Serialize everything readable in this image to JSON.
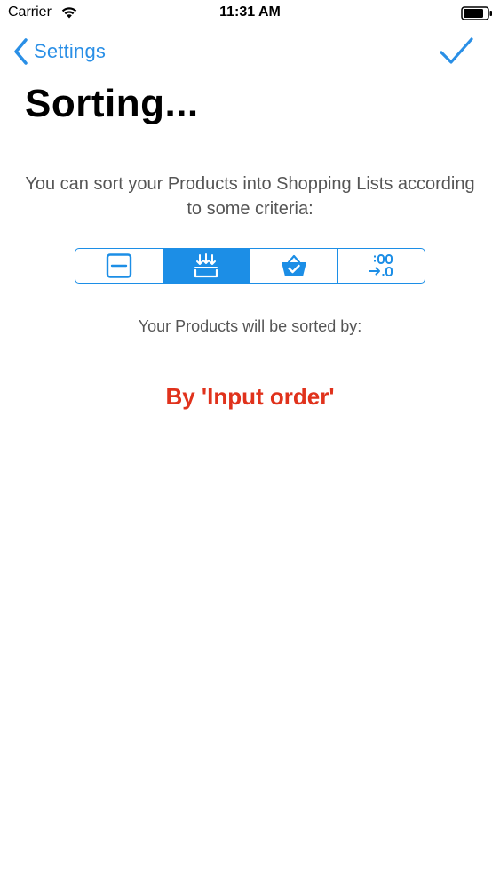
{
  "status_bar": {
    "carrier": "Carrier",
    "time": "11:31 AM",
    "icons": [
      "wifi-icon",
      "battery-icon"
    ]
  },
  "nav": {
    "back_label": "Settings",
    "back_icon": "chevron-left-icon",
    "done_icon": "checkmark-icon",
    "title": "Sorting..."
  },
  "content": {
    "intro": "You can sort your Products into Shopping Lists according to some criteria:",
    "segments": [
      {
        "icon": "box-minus-icon",
        "selected": false
      },
      {
        "icon": "input-order-icon",
        "selected": true
      },
      {
        "icon": "basket-check-icon",
        "selected": false
      },
      {
        "icon": "numeric-sort-icon",
        "selected": false
      }
    ],
    "sorted_by_label": "Your Products will be sorted by:",
    "sort_value": "By 'Input order'"
  },
  "colors": {
    "accent": "#1c8ee6",
    "link": "#2a8fe6",
    "highlight": "#e0321c",
    "secondary_text": "#555555"
  }
}
